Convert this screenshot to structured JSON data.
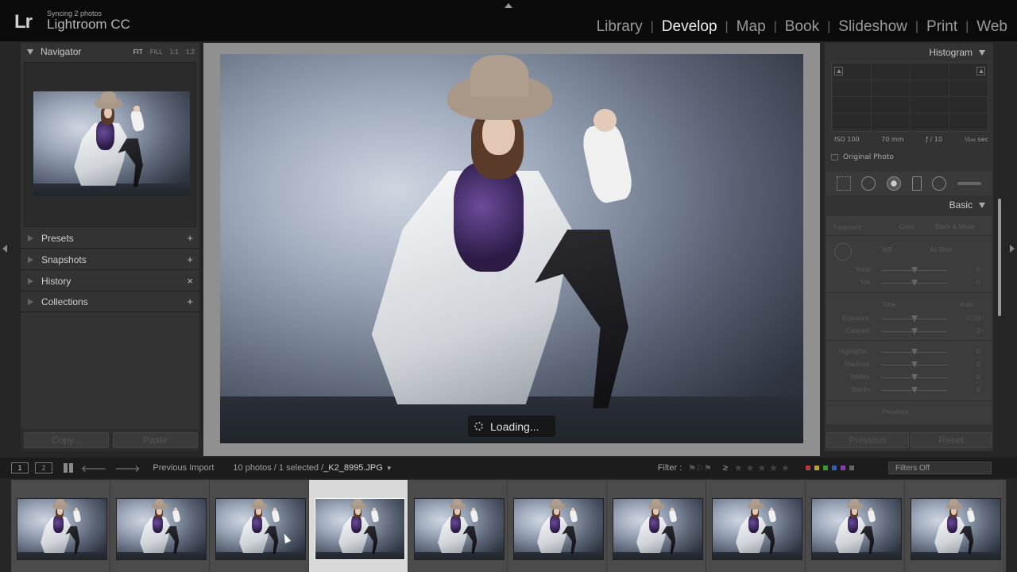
{
  "top": {
    "logo": "Lr",
    "sync_status": "Syncing 2 photos",
    "app_name": "Lightroom CC",
    "modules": [
      "Library",
      "Develop",
      "Map",
      "Book",
      "Slideshow",
      "Print",
      "Web"
    ],
    "active_module": "Develop"
  },
  "left_panel": {
    "navigator": {
      "title": "Navigator",
      "zoom_options": [
        "FIT",
        "FILL",
        "1:1",
        "1:2"
      ],
      "active_zoom": "FIT"
    },
    "sections": [
      {
        "label": "Presets",
        "action": "+"
      },
      {
        "label": "Snapshots",
        "action": "+"
      },
      {
        "label": "History",
        "action": "×"
      },
      {
        "label": "Collections",
        "action": "+"
      }
    ],
    "buttons": {
      "copy": "Copy...",
      "paste": "Paste"
    }
  },
  "center": {
    "loading_text": "Loading..."
  },
  "right_panel": {
    "histogram_title": "Histogram",
    "exif": {
      "iso": "ISO 100",
      "focal": "70 mm",
      "aperture": "ƒ / 10",
      "shutter": "¹⁄₂₀₀ sec"
    },
    "original_photo_label": "Original Photo",
    "basic_title": "Basic",
    "basic": {
      "treatment_label": "Treatment :",
      "treatment_color": "Color",
      "treatment_bw": "Black & White",
      "wb_label": "WB :",
      "wb_value": "As Shot",
      "temp": {
        "label": "Temp",
        "value": "0"
      },
      "tint": {
        "label": "Tint",
        "value": "0"
      },
      "tone_label": "Tone",
      "auto_label": "Auto",
      "exposure": {
        "label": "Exposure",
        "value": "0.00"
      },
      "contrast": {
        "label": "Contrast",
        "value": "0"
      },
      "highlights": {
        "label": "Highlights",
        "value": "0"
      },
      "shadows": {
        "label": "Shadows",
        "value": "0"
      },
      "whites": {
        "label": "Whites",
        "value": "0"
      },
      "blacks": {
        "label": "Blacks",
        "value": "0"
      },
      "presence_label": "Presence"
    },
    "buttons": {
      "previous": "Previous",
      "reset": "Reset"
    }
  },
  "filmstrip_bar": {
    "page1": "1",
    "page2": "2",
    "source": "Previous Import",
    "count_info": "10 photos / 1 selected /",
    "filename": "_K2_8995.JPG",
    "filter_label": "Filter :",
    "rating_op": "≥",
    "stars": "★★★★★",
    "filter_select": "Filters Off"
  },
  "filmstrip": {
    "count": 10,
    "selected_index": 3
  },
  "colors": {
    "accent_active": "#eeeeee",
    "panel": "#333333",
    "background": "#262626",
    "label_red": "#b33a3a",
    "label_yellow": "#b8a33a",
    "label_green": "#3a9a3a",
    "label_blue": "#3a5ab3",
    "label_purple": "#8a3ab3"
  }
}
